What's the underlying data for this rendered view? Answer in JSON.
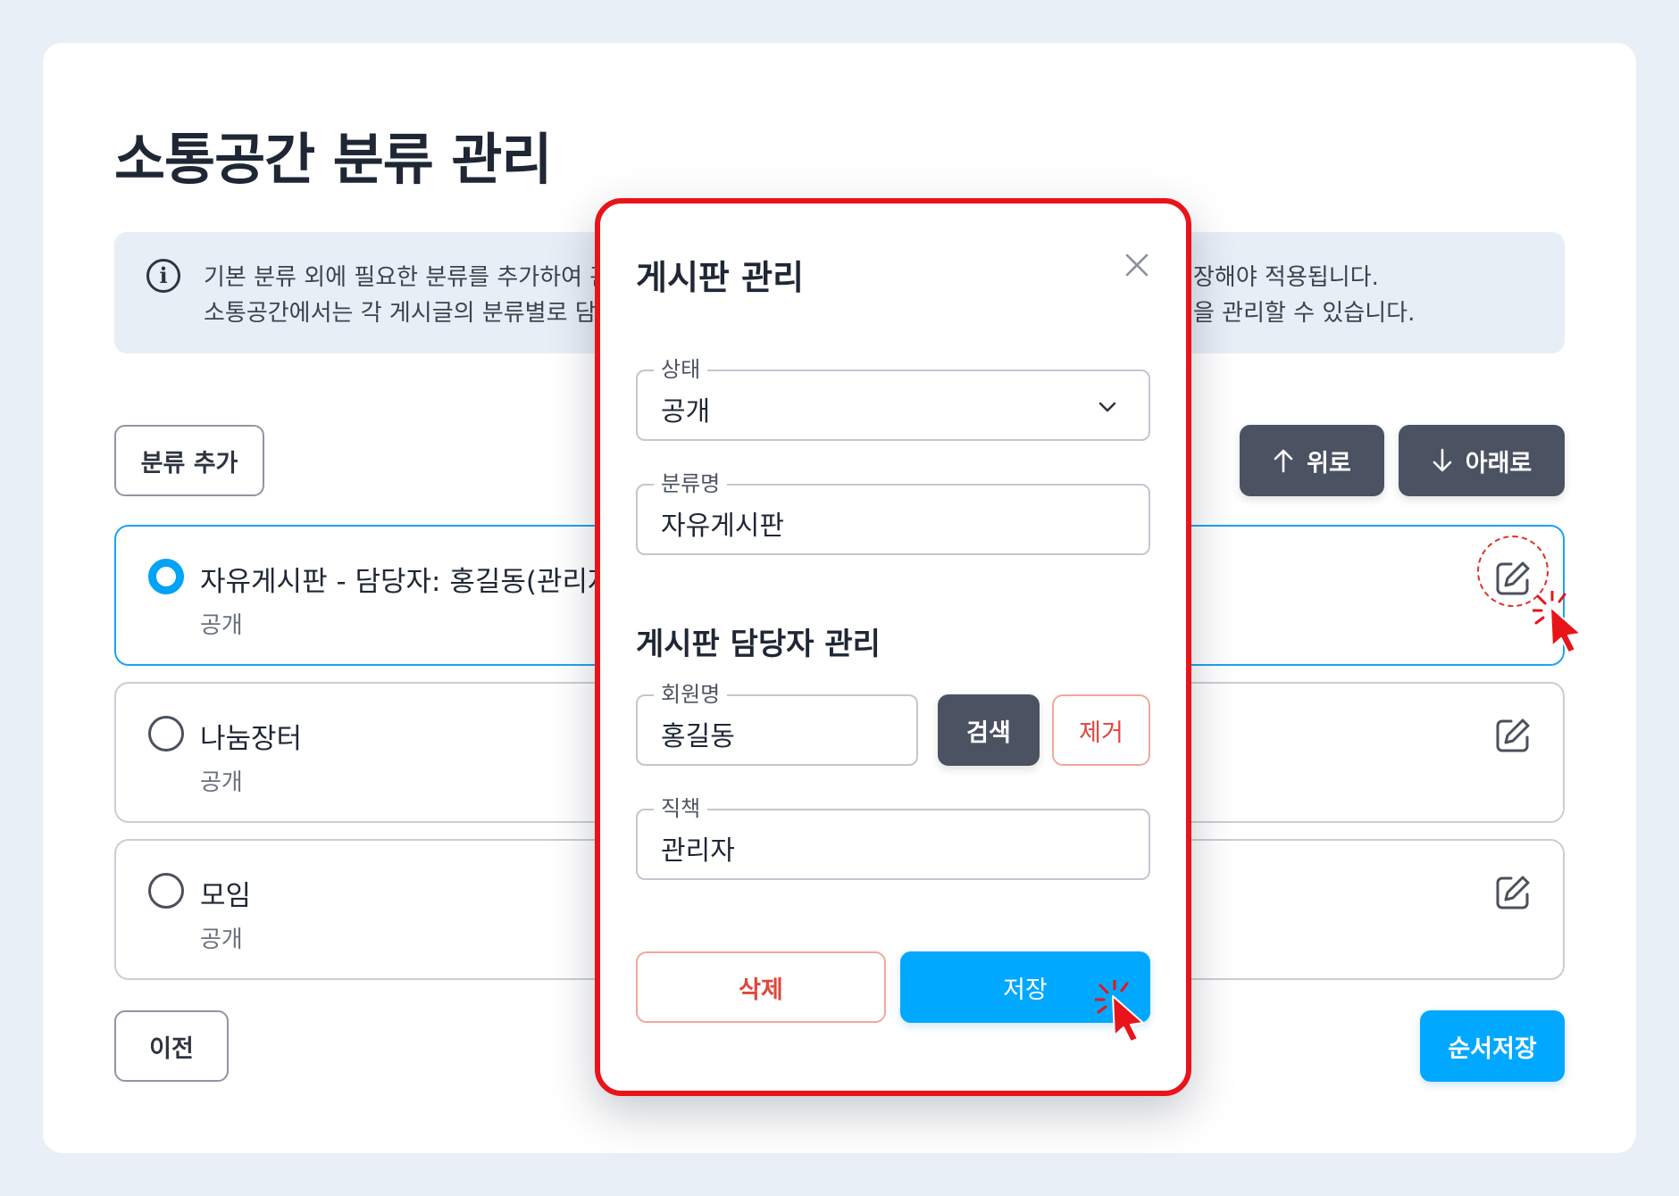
{
  "page": {
    "title": "소통공간 분류 관리",
    "info_lines": [
      "기본 분류 외에 필요한 분류를 추가하여 관",
      "소통공간에서는 각 게시글의 분류별로 담"
    ],
    "info_lines_right": [
      "장해야 적용됩니다.",
      "을 관리할 수 있습니다."
    ]
  },
  "toolbar": {
    "add_label": "분류 추가",
    "up_label": "위로",
    "down_label": "아래로"
  },
  "categories": [
    {
      "title": "자유게시판  - 담당자: 홍길동(관리자",
      "status": "공개",
      "selected": true
    },
    {
      "title": "나눔장터",
      "status": "공개",
      "selected": false
    },
    {
      "title": "모임",
      "status": "공개",
      "selected": false
    }
  ],
  "footer": {
    "prev_label": "이전",
    "save_order_label": "순서저장"
  },
  "modal": {
    "title": "게시판 관리",
    "status_label": "상태",
    "status_value": "공개",
    "name_label": "분류명",
    "name_value": "자유게시판",
    "manager_section_title": "게시판 담당자 관리",
    "member_label": "회원명",
    "member_value": "홍길동",
    "search_label": "검색",
    "remove_label": "제거",
    "position_label": "직책",
    "position_value": "관리자",
    "delete_label": "삭제",
    "save_label": "저장"
  },
  "colors": {
    "accent_blue": "#00a8ff",
    "dark_button": "#4b5262",
    "danger": "#e0473a",
    "highlight_border": "#e8141a"
  }
}
